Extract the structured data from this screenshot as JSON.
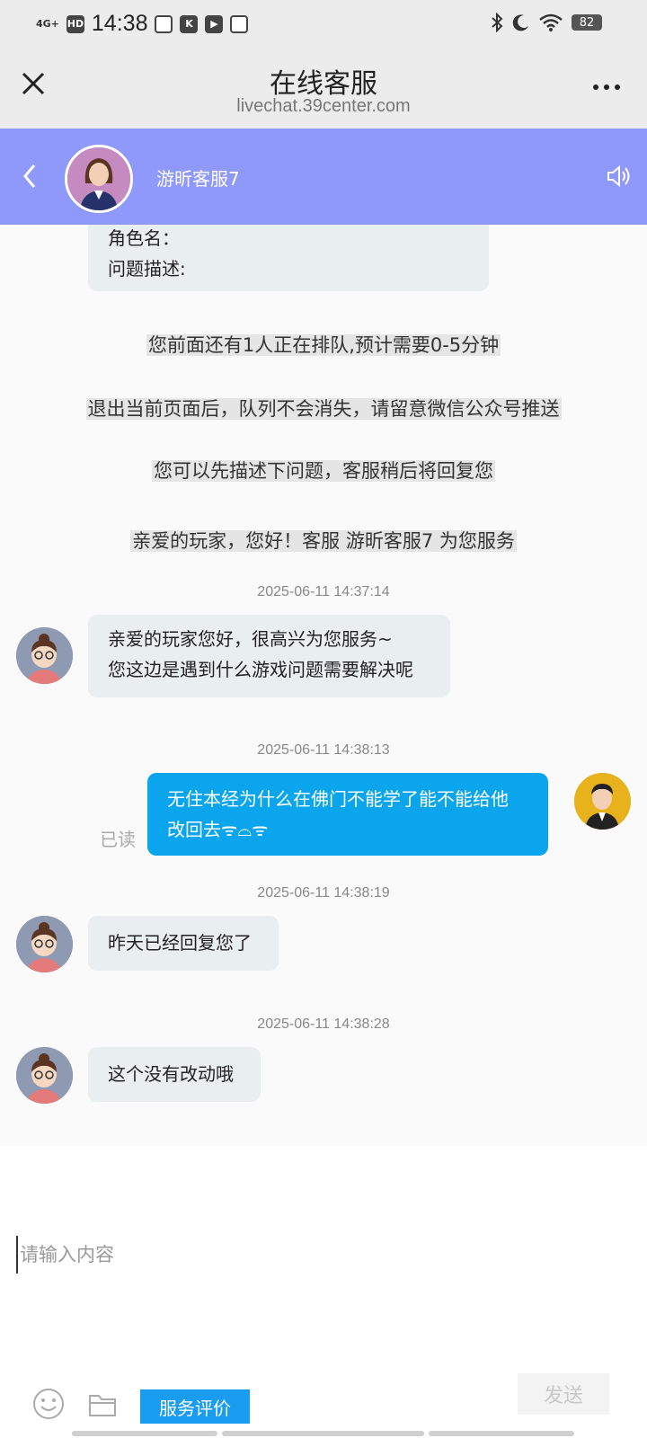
{
  "status_bar": {
    "network": "4G+",
    "hd": "HD",
    "time": "14:38",
    "battery": "82"
  },
  "titlebar": {
    "title": "在线客服",
    "subtitle": "livechat.39center.com"
  },
  "chat_header": {
    "agent_name": "游昕客服7"
  },
  "form_card": {
    "line1": "角色名：",
    "line2": "问题描述:"
  },
  "system_messages": [
    "您前面还有1人正在排队,预计需要0-5分钟",
    "退出当前页面后，队列不会消失，请留意微信公众号推送",
    "您可以先描述下问题，客服稍后将回复您",
    "亲爱的玩家，您好！客服 游昕客服7 为您服务"
  ],
  "messages": [
    {
      "timestamp": "2025-06-11 14:37:14",
      "from": "agent",
      "line1": "亲爱的玩家您好，很高兴为您服务~",
      "line2": "您这边是遇到什么游戏问题需要解决呢"
    },
    {
      "timestamp": "2025-06-11 14:38:13",
      "from": "me",
      "line1": "无住本经为什么在佛门不能学了能不能给他",
      "line2": "改回去ᯤ⌓ᯤ",
      "read": "已读"
    },
    {
      "timestamp": "2025-06-11 14:38:19",
      "from": "agent",
      "line1": "昨天已经回复您了"
    },
    {
      "timestamp": "2025-06-11 14:38:28",
      "from": "agent",
      "line1": "这个没有改动哦"
    }
  ],
  "composer": {
    "placeholder": "请输入内容",
    "rate_label": "服务评价",
    "send_label": "发送"
  },
  "colors": {
    "header": "#8f99fb",
    "my_bubble": "#0aa5ec",
    "rate_button": "#1a9cf0"
  },
  "icons": [
    "close-icon",
    "more-icon",
    "back-icon",
    "speaker-icon",
    "emoji-icon",
    "folder-icon"
  ]
}
